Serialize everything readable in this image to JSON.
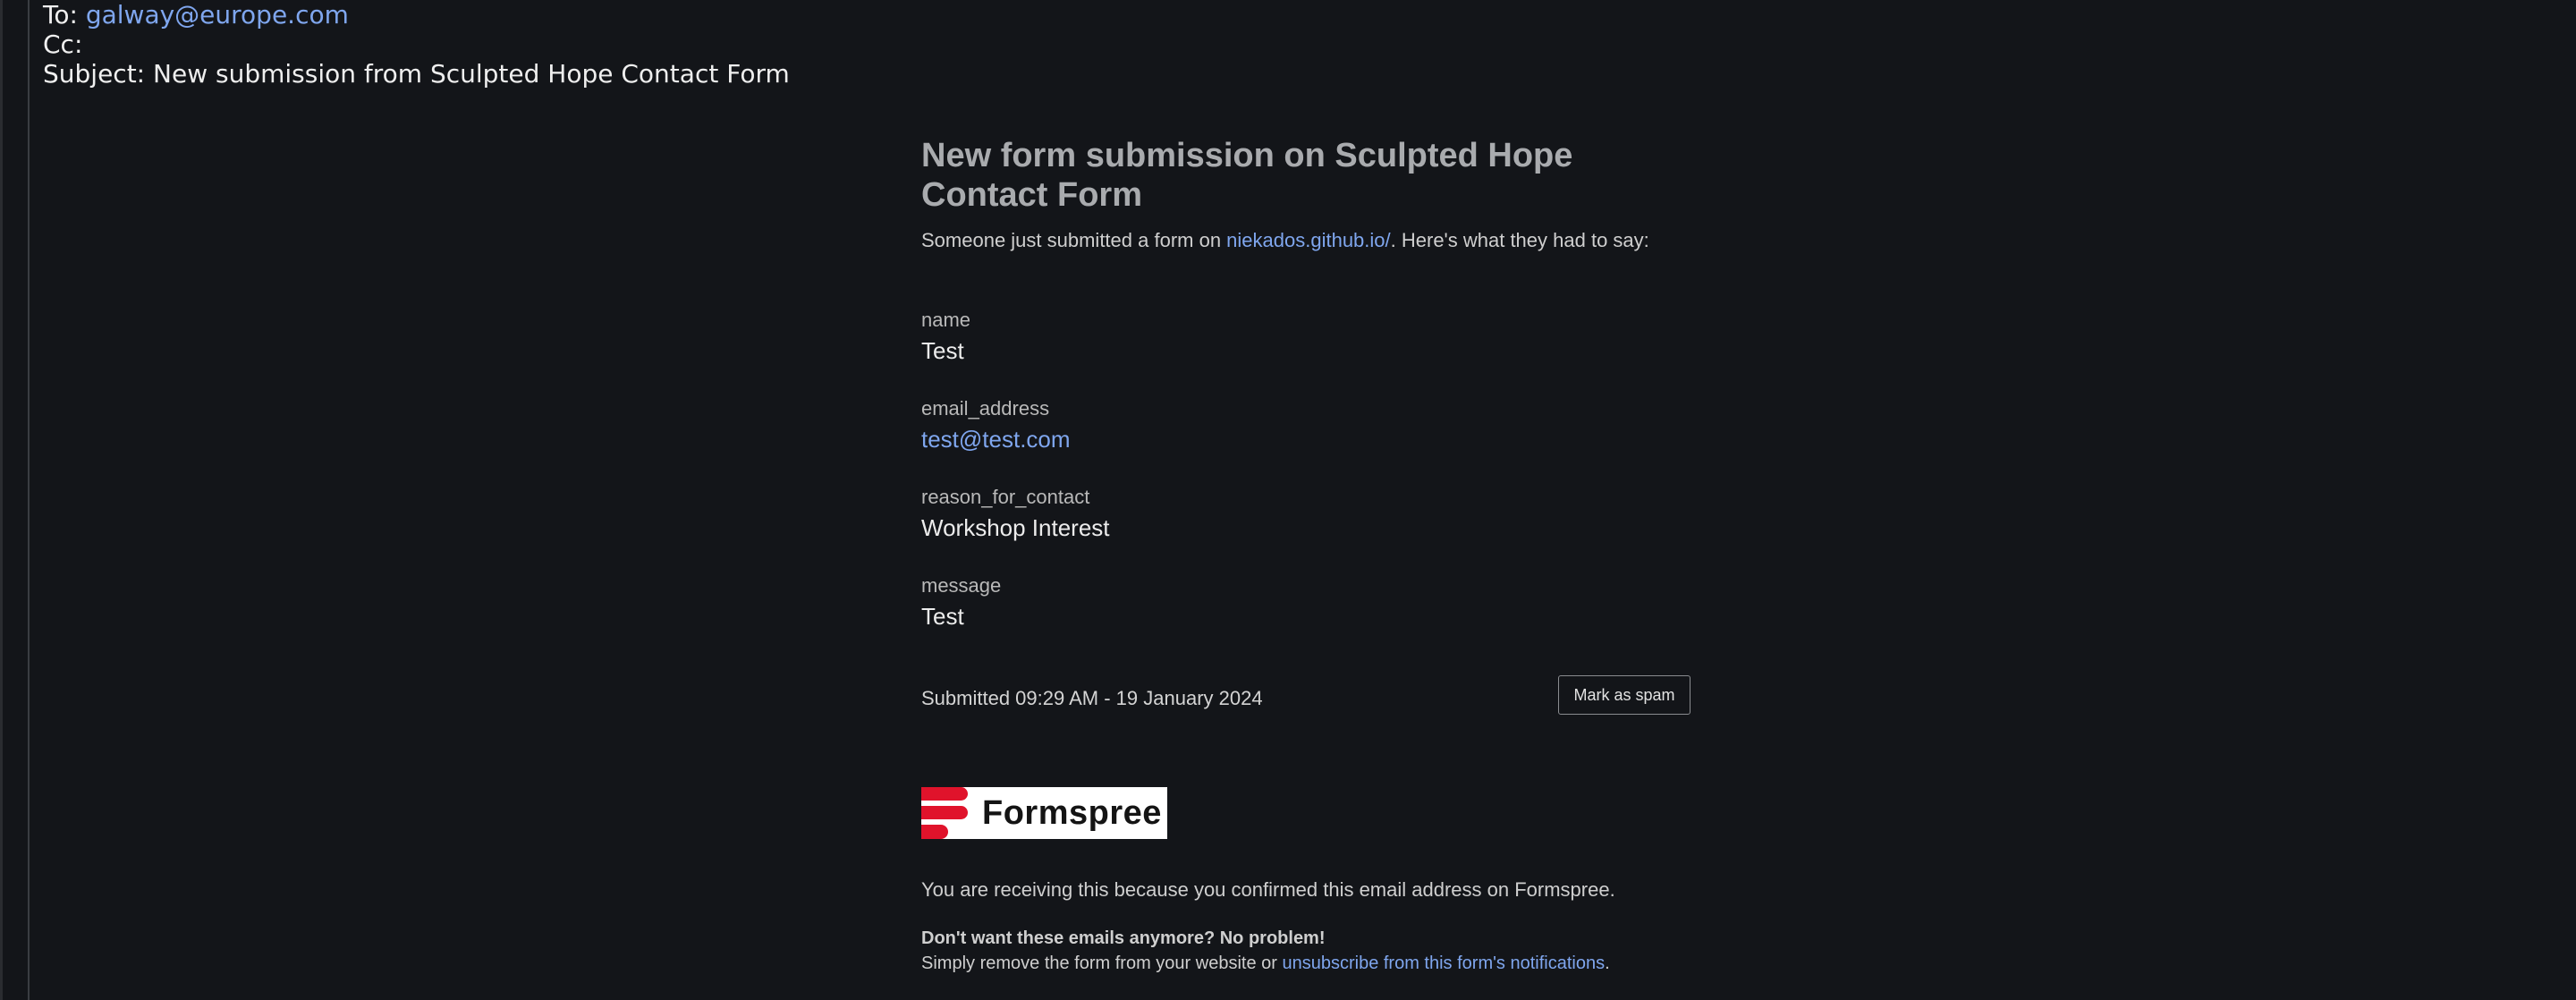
{
  "email_header": {
    "to_label": "To:",
    "to_address": "galway@europe.com",
    "cc_label": "Cc:",
    "subject_label": "Subject:",
    "subject": "New submission from Sculpted Hope Contact Form"
  },
  "body": {
    "title": "New form submission on Sculpted Hope Contact Form",
    "intro_prefix": "Someone just submitted a form on ",
    "intro_link": "niekados.github.io/",
    "intro_suffix": ". Here's what they had to say:",
    "fields": [
      {
        "label": "name",
        "value": "Test"
      },
      {
        "label": "email_address",
        "value": "test@test.com"
      },
      {
        "label": "reason_for_contact",
        "value": "Workshop Interest"
      },
      {
        "label": "message",
        "value": "Test"
      }
    ],
    "submitted": "Submitted 09:29 AM - 19 January 2024",
    "spam_button": "Mark as spam"
  },
  "footer": {
    "logo_text": "Formspree",
    "receiving": "You are receiving this because you confirmed this email address on Formspree.",
    "dont_want": "Don't want these emails anymore? No problem!",
    "simply_prefix": "Simply remove the form from your website or ",
    "unsubscribe_link": "unsubscribe from this form's notifications",
    "simply_suffix": "."
  },
  "colors": {
    "background": "#131519",
    "link": "#7fa6ee",
    "logo_red": "#e0132b"
  }
}
